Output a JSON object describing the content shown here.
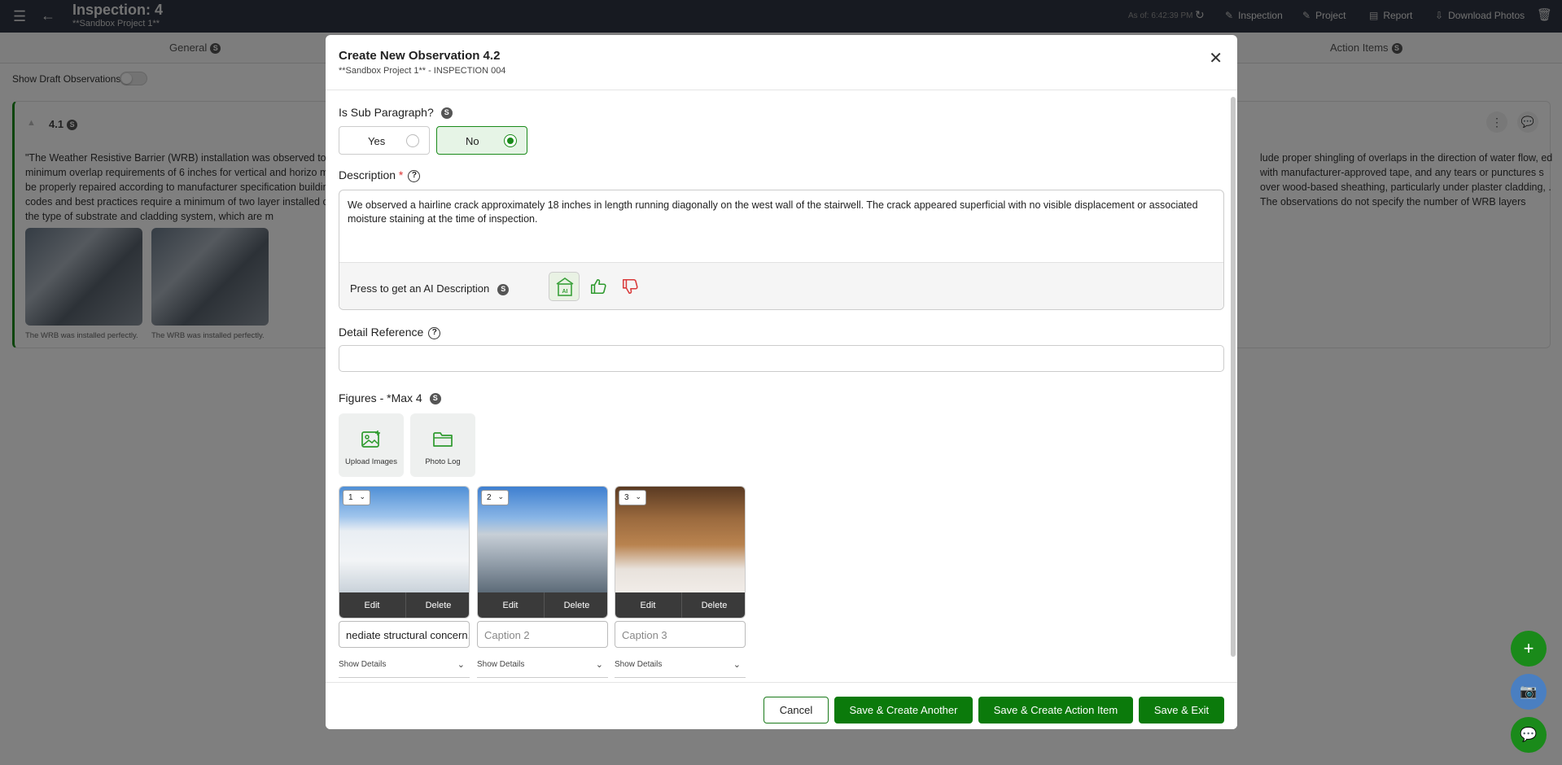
{
  "topbar": {
    "title": "Inspection: 4",
    "subtitle": "**Sandbox Project 1**",
    "as_of": "As of: 6:42:39 PM",
    "links": {
      "inspection": "Inspection",
      "project": "Project",
      "report": "Report",
      "download_photos": "Download Photos"
    }
  },
  "tabs": {
    "general": "General",
    "general_badge": "S",
    "action_items": "Action Items",
    "action_items_badge": "S"
  },
  "background": {
    "show_draft_label": "Show Draft Observations",
    "observation_number": "4.1",
    "observation_badge": "S",
    "observation_text_left": "\"The Weather Resistive Barrier (WRB) installation was observed to minimum overlap requirements of 6 inches for vertical and horizo must be properly repaired according to manufacturer specification building codes and best practices require a minimum of two layer installed or the type of substrate and cladding system, which are m",
    "observation_text_right": "lude proper shingling of overlaps in the direction of water flow, ed with manufacturer-approved tape, and any tears or punctures s over wood-based sheathing, particularly under plaster cladding, . The observations do not specify the number of WRB layers",
    "thumb_caption_1": "The WRB was installed perfectly.",
    "thumb_caption_2": "The WRB was installed perfectly."
  },
  "modal": {
    "title": "Create New Observation 4.2",
    "subtitle": "**Sandbox Project 1** - INSPECTION 004",
    "sub_paragraph_label": "Is Sub Paragraph?",
    "sub_paragraph_badge": "S",
    "option_yes": "Yes",
    "option_no": "No",
    "selected_option": "No",
    "description_label": "Description",
    "description_required": "*",
    "description_value": "We observed a hairline crack approximately 18 inches in length running diagonally on the west wall of the stairwell. The crack appeared superficial with no visible displacement or associated moisture staining at the time of inspection.",
    "ai_label": "Press to get an AI Description",
    "ai_badge": "S",
    "detail_reference_label": "Detail Reference",
    "detail_reference_value": "",
    "figures_label": "Figures - *Max 4",
    "figures_badge": "S",
    "upload_images": "Upload Images",
    "photo_log": "Photo Log",
    "figures": [
      {
        "order": "1",
        "edit": "Edit",
        "delete": "Delete",
        "caption": "nediate structural concern.",
        "caption_placeholder": "Caption 1",
        "show_details": "Show Details"
      },
      {
        "order": "2",
        "edit": "Edit",
        "delete": "Delete",
        "caption": "",
        "caption_placeholder": "Caption 2",
        "show_details": "Show Details"
      },
      {
        "order": "3",
        "edit": "Edit",
        "delete": "Delete",
        "caption": "",
        "caption_placeholder": "Caption 3",
        "show_details": "Show Details"
      }
    ],
    "buttons": {
      "cancel": "Cancel",
      "save_create_another": "Save & Create Another",
      "save_create_action_item": "Save & Create Action Item",
      "save_exit": "Save & Exit"
    }
  },
  "colors": {
    "accent_green": "#0b7a0b",
    "topbar": "#2f3542",
    "fab_green": "#1a8a1a",
    "fab_blue": "#4a7fc1",
    "thumb_down_red": "#d93a3a"
  }
}
